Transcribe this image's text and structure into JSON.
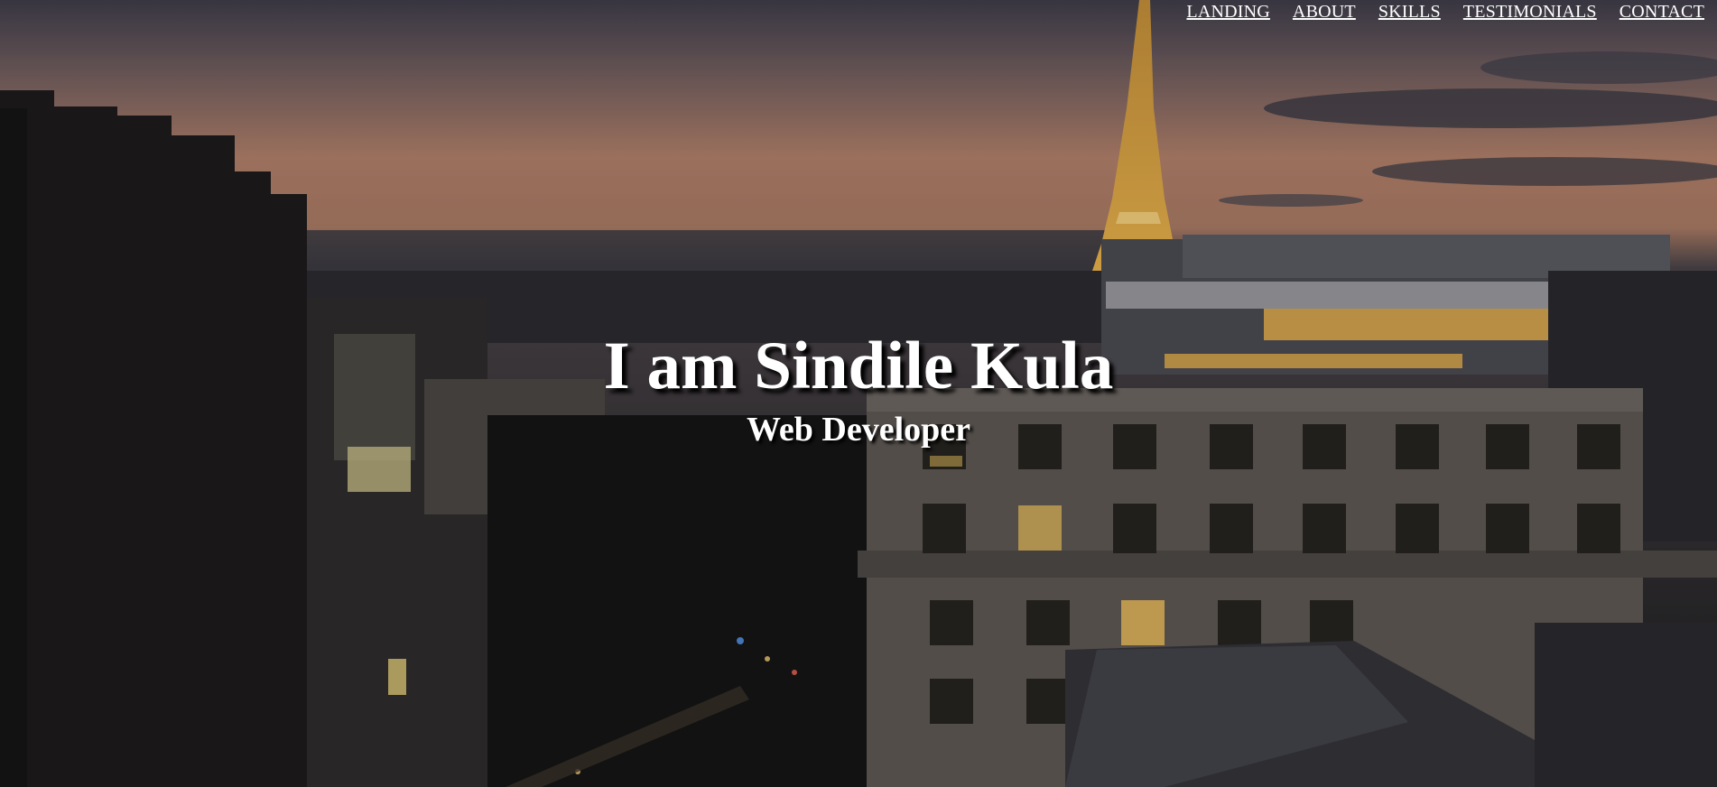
{
  "nav": {
    "items": [
      "LANDING",
      "ABOUT",
      "SKILLS",
      "TESTIMONIALS",
      "CONTACT"
    ]
  },
  "hero": {
    "title": "I am Sindile Kula",
    "subtitle": "Web Developer"
  },
  "colors": {
    "text": "#ffffff",
    "shadow": "#000000",
    "sky_glow": "#b88466",
    "tower_light": "#e8b04a",
    "window_light": "#f2c566"
  }
}
